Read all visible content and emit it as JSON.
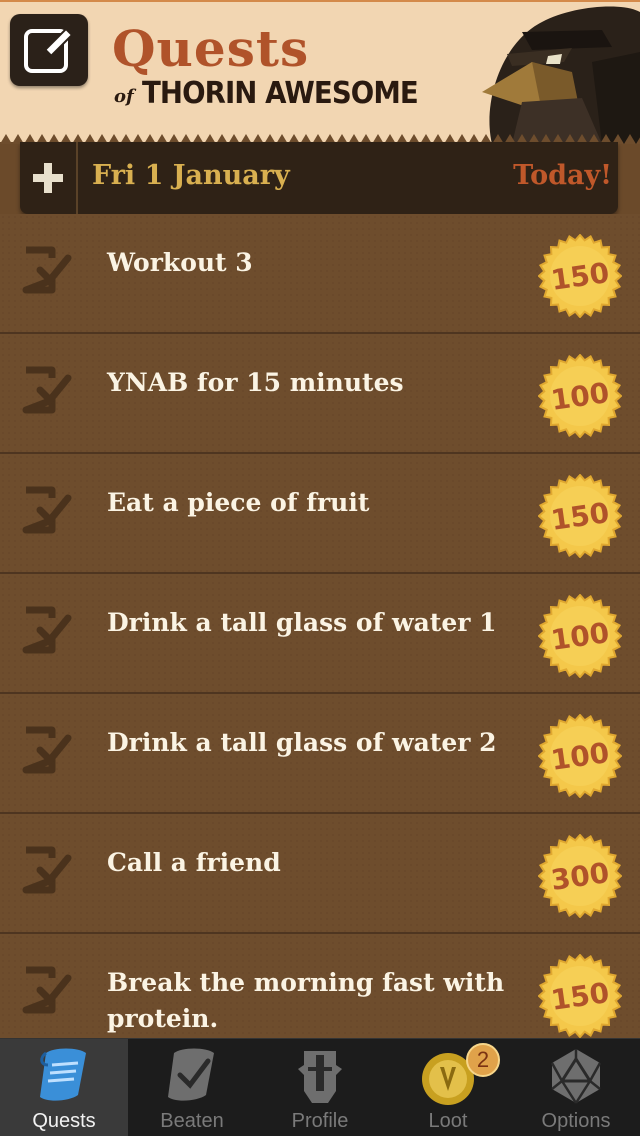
{
  "header": {
    "title": "Quests",
    "of": "of",
    "subtitle": "THORIN AWESOME"
  },
  "date_bar": {
    "date": "Fri 1 January",
    "today": "Today!"
  },
  "quests": [
    {
      "title": "Workout 3",
      "reward": "150"
    },
    {
      "title": "YNAB for 15 minutes",
      "reward": "100"
    },
    {
      "title": "Eat a piece of fruit",
      "reward": "150"
    },
    {
      "title": "Drink a tall glass of water 1",
      "reward": "100"
    },
    {
      "title": "Drink a tall glass of water 2",
      "reward": "100"
    },
    {
      "title": "Call a friend",
      "reward": "300"
    },
    {
      "title": "Break the morning fast with protein.",
      "reward": "150"
    }
  ],
  "tabs": [
    {
      "label": "Quests",
      "icon": "scroll-icon",
      "active": true
    },
    {
      "label": "Beaten",
      "icon": "checked-scroll-icon",
      "active": false
    },
    {
      "label": "Profile",
      "icon": "profile-icon",
      "active": false
    },
    {
      "label": "Loot",
      "icon": "coin-icon",
      "active": false,
      "badge": "2"
    },
    {
      "label": "Options",
      "icon": "dice-icon",
      "active": false
    }
  ],
  "colors": {
    "header_bg": "#f2d6b2",
    "title": "#b0532a",
    "wood": "#6e4d2d",
    "date_text": "#d9b050",
    "today_text": "#c0582a",
    "coin": "#f4c84a"
  }
}
